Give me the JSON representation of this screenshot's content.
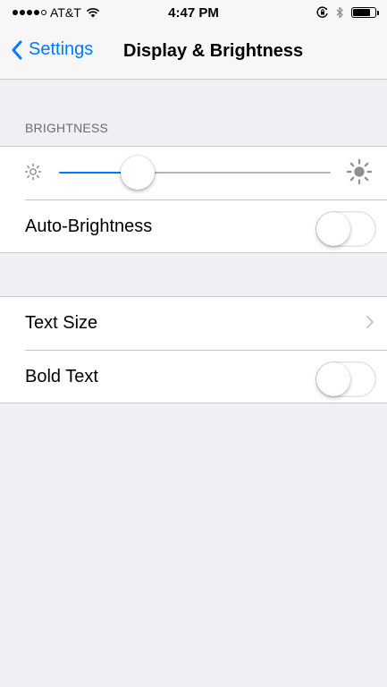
{
  "status_bar": {
    "carrier": "AT&T",
    "time": "4:47 PM",
    "signal_bars_filled": 4,
    "signal_bars_total": 5,
    "battery_level": 0.85
  },
  "nav": {
    "back_label": "Settings",
    "title": "Display & Brightness"
  },
  "brightness_section": {
    "header": "BRIGHTNESS",
    "slider_value": 0.29,
    "auto_brightness_label": "Auto-Brightness",
    "auto_brightness_on": false
  },
  "text_section": {
    "text_size_label": "Text Size",
    "bold_text_label": "Bold Text",
    "bold_text_on": false
  },
  "colors": {
    "accent": "#007aff",
    "background": "#efeff4",
    "separator": "#c8c7cc",
    "section_header": "#6d6d72"
  },
  "icons": {
    "back": "chevron-left-icon",
    "wifi": "wifi-icon",
    "orientation_lock": "orientation-lock-icon",
    "bluetooth": "bluetooth-icon",
    "battery": "battery-icon",
    "brightness_low": "sun-small-icon",
    "brightness_high": "sun-large-icon",
    "disclosure": "chevron-right-icon"
  }
}
